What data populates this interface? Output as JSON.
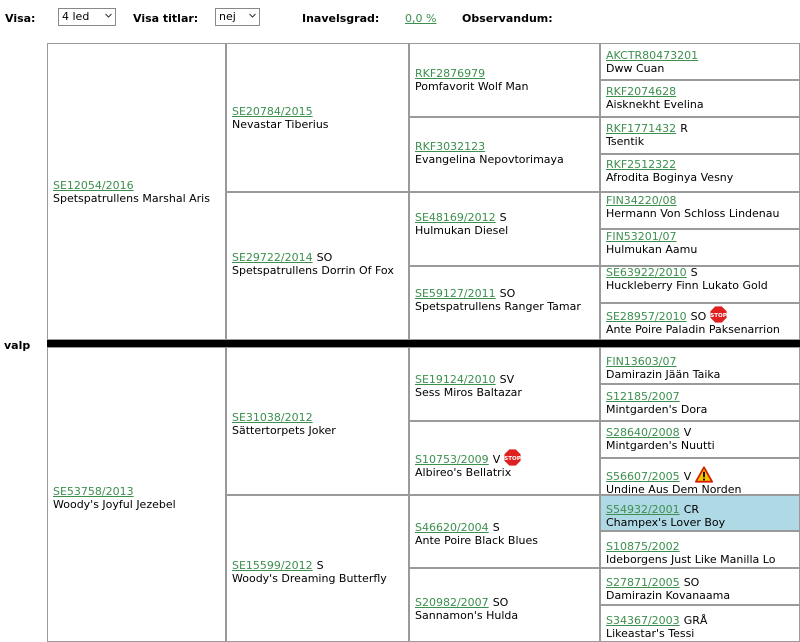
{
  "toolbar": {
    "visa_label": "Visa:",
    "visa_value": "4 led",
    "titlar_label": "Visa titlar:",
    "titlar_value": "nej",
    "inavel_label": "Inavelsgrad:",
    "inavel_value": "0,0 %",
    "observandum_label": "Observandum:"
  },
  "pup_label": "valp",
  "colors": {
    "link": "#3d8f4f",
    "highlight": "#b0d9e6",
    "separator": "#000000"
  },
  "gen1": [
    {
      "reg": "SE12054/2016",
      "title": "",
      "name": "Spetspatrullens Marshal Aris"
    },
    {
      "reg": "SE53758/2013",
      "title": "",
      "name": "Woody's Joyful Jezebel"
    }
  ],
  "gen2": [
    {
      "reg": "SE20784/2015",
      "title": "",
      "name": "Nevastar Tiberius"
    },
    {
      "reg": "SE29722/2014",
      "title": "SO",
      "name": "Spetspatrullens Dorrin Of Fox"
    },
    {
      "reg": "SE31038/2012",
      "title": "",
      "name": "Sättertorpets Joker"
    },
    {
      "reg": "SE15599/2012",
      "title": "S",
      "name": "Woody's Dreaming Butterfly"
    }
  ],
  "gen3": [
    {
      "reg": "RKF2876979",
      "title": "",
      "name": "Pomfavorit Wolf Man"
    },
    {
      "reg": "RKF3032123",
      "title": "",
      "name": "Evangelina Nepovtorimaya"
    },
    {
      "reg": "SE48169/2012",
      "title": "S",
      "name": "Hulmukan Diesel"
    },
    {
      "reg": "SE59127/2011",
      "title": "SO",
      "name": "Spetspatrullens Ranger Tamar"
    },
    {
      "reg": "SE19124/2010",
      "title": "SV",
      "name": "Sess Miros Baltazar"
    },
    {
      "reg": "S10753/2009",
      "title": "V",
      "name": "Albireo's Bellatrix",
      "icon": "stop-sign-icon"
    },
    {
      "reg": "S46620/2004",
      "title": "S",
      "name": "Ante Poire Black Blues"
    },
    {
      "reg": "S20982/2007",
      "title": "SO",
      "name": "Sannamon's Hulda"
    }
  ],
  "gen4": [
    {
      "reg": "AKCTR80473201",
      "title": "",
      "name": "Dww Cuan"
    },
    {
      "reg": "RKF2074628",
      "title": "",
      "name": "Aisknekht Evelina"
    },
    {
      "reg": "RKF1771432",
      "title": "R",
      "name": "Tsentik"
    },
    {
      "reg": "RKF2512322",
      "title": "",
      "name": "Afrodita Boginya Vesny"
    },
    {
      "reg": "FIN34220/08",
      "title": "",
      "name": "Hermann Von Schloss Lindenau"
    },
    {
      "reg": "FIN53201/07",
      "title": "",
      "name": "Hulmukan Aamu"
    },
    {
      "reg": "SE63922/2010",
      "title": "S",
      "name": "Huckleberry Finn Lukato Gold"
    },
    {
      "reg": "SE28957/2010",
      "title": "SO",
      "name": "Ante Poire Paladin Paksenarrion",
      "icon": "stop-sign-icon"
    },
    {
      "reg": "FIN13603/07",
      "title": "",
      "name": "Damirazin Jään Taika"
    },
    {
      "reg": "S12185/2007",
      "title": "",
      "name": "Mintgarden's Dora"
    },
    {
      "reg": "S28640/2008",
      "title": "V",
      "name": "Mintgarden's Nuutti"
    },
    {
      "reg": "S56607/2005",
      "title": "V",
      "name": "Undine Aus Dem Norden",
      "icon": "warning-icon"
    },
    {
      "reg": "S54932/2001",
      "title": "CR",
      "name": "Champex's Lover Boy",
      "highlight": true
    },
    {
      "reg": "S10875/2002",
      "title": "",
      "name": "Ideborgens Just Like Manilla Lo"
    },
    {
      "reg": "S27871/2005",
      "title": "SO",
      "name": "Damirazin Kovanaama"
    },
    {
      "reg": "S34367/2003",
      "title": "GRÅ",
      "name": "Likeastar's Tessi"
    }
  ]
}
